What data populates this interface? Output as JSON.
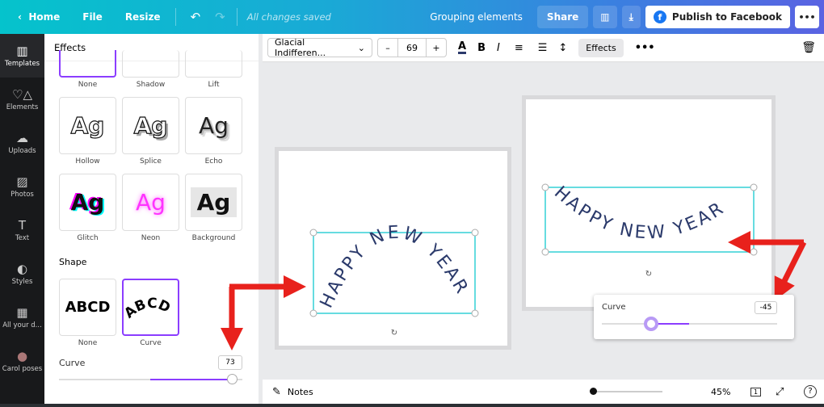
{
  "topbar": {
    "home": "Home",
    "file": "File",
    "resize": "Resize",
    "saved": "All changes saved",
    "design_title": "Grouping elements",
    "share": "Share",
    "publish": "Publish to Facebook",
    "more": "•••"
  },
  "sidebar": [
    {
      "label": "Templates",
      "icon": "▥"
    },
    {
      "label": "Elements",
      "icon": "♡△"
    },
    {
      "label": "Uploads",
      "icon": "☁"
    },
    {
      "label": "Photos",
      "icon": "▨"
    },
    {
      "label": "Text",
      "icon": "T"
    },
    {
      "label": "Styles",
      "icon": "◐"
    },
    {
      "label": "All your d...",
      "icon": "▦"
    },
    {
      "label": "Carol poses",
      "icon": "●"
    }
  ],
  "panel": {
    "title": "Effects",
    "effects": [
      "None",
      "Shadow",
      "Lift",
      "Hollow",
      "Splice",
      "Echo",
      "Glitch",
      "Neon",
      "Background"
    ],
    "sample": "Ag",
    "shape_heading": "Shape",
    "shapes": [
      {
        "label": "None",
        "sample": "ABCD"
      },
      {
        "label": "Curve",
        "sample": "ABCD"
      }
    ],
    "curve_label": "Curve",
    "curve_value": "73"
  },
  "toolbar": {
    "font": "Glacial Indifferen...",
    "size": "69",
    "effects": "Effects",
    "more": "•••"
  },
  "canvas": {
    "text": "HAPPY NEW YEAR",
    "popup_label": "Curve",
    "popup_value": "-45",
    "popup_level": -45,
    "panel_level": 73
  },
  "bottom": {
    "notes": "Notes",
    "zoom": "45%",
    "pages": "1"
  },
  "colors": {
    "accent": "#8b3dff",
    "selection": "#00c4cc",
    "arrow": "#e8211c",
    "text": "#2b3a6b"
  }
}
